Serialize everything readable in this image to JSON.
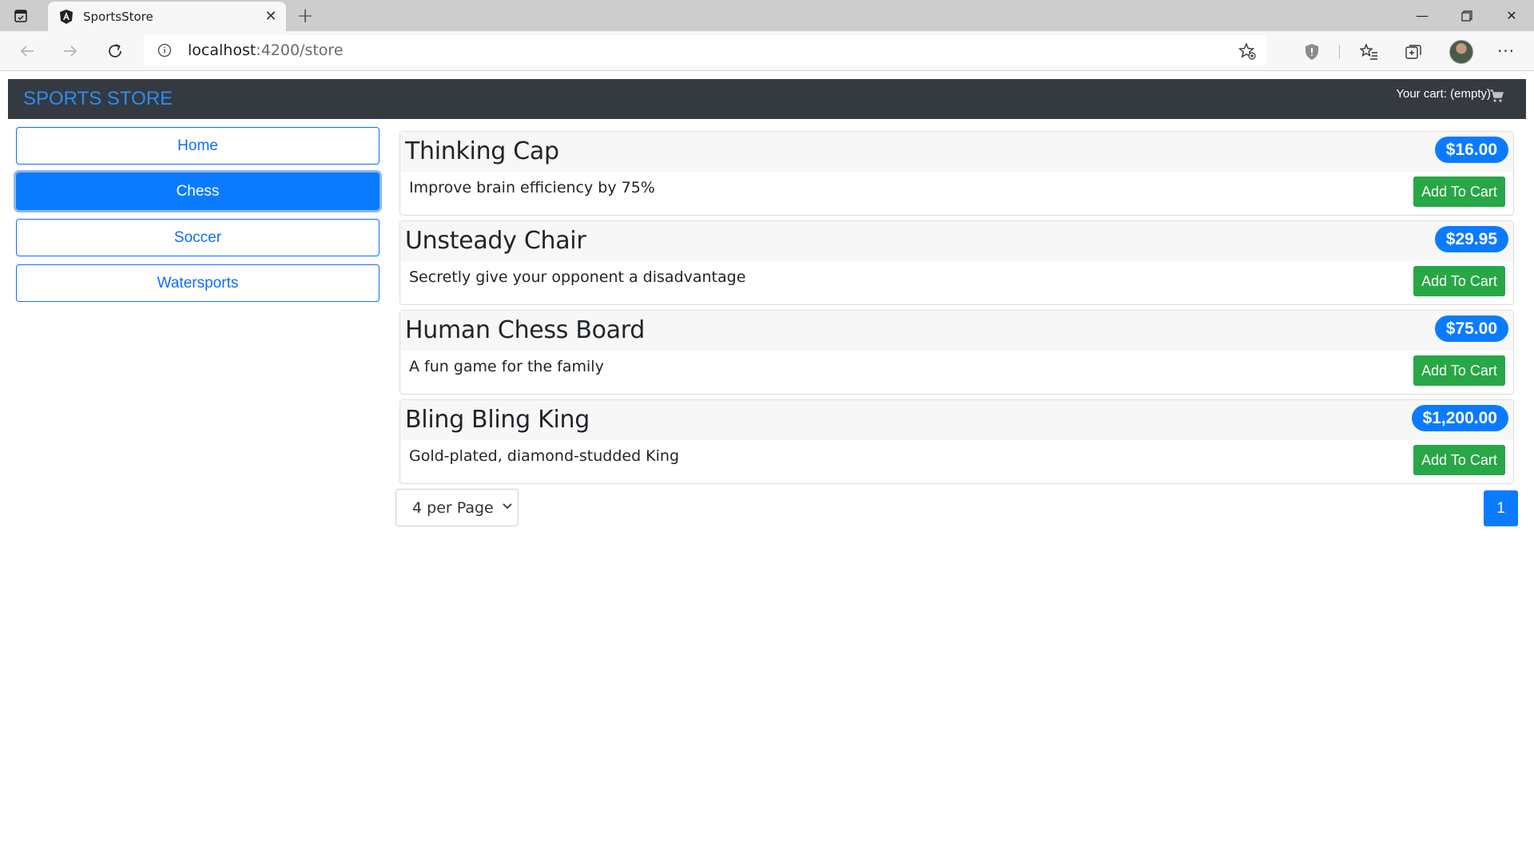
{
  "browser": {
    "tab_title": "SportsStore",
    "url_host": "localhost",
    "url_rest": ":4200/store",
    "icons": [
      "tab-actions-icon",
      "angular-icon",
      "close-icon",
      "plus-icon",
      "minimize-icon",
      "restore-icon",
      "close-window-icon",
      "back-icon",
      "forward-icon",
      "reload-icon",
      "info-icon",
      "add-favorite-icon",
      "shield-extension-icon",
      "favorites-icon",
      "collections-icon",
      "profile-avatar",
      "more-icon"
    ]
  },
  "header": {
    "brand": "SPORTS STORE",
    "cart_summary": "Your cart: (empty)",
    "cart_icon": "cart-icon"
  },
  "categories": [
    {
      "label": "Home",
      "active": false
    },
    {
      "label": "Chess",
      "active": true
    },
    {
      "label": "Soccer",
      "active": false
    },
    {
      "label": "Watersports",
      "active": false
    }
  ],
  "products": [
    {
      "name": "Thinking Cap",
      "price": "$16.00",
      "description": "Improve brain efficiency by 75%",
      "button": "Add To Cart"
    },
    {
      "name": "Unsteady Chair",
      "price": "$29.95",
      "description": "Secretly give your opponent a disadvantage",
      "button": "Add To Cart"
    },
    {
      "name": "Human Chess Board",
      "price": "$75.00",
      "description": "A fun game for the family",
      "button": "Add To Cart"
    },
    {
      "name": "Bling Bling King",
      "price": "$1,200.00",
      "description": "Gold-plated, diamond-studded King",
      "button": "Add To Cart"
    }
  ],
  "pagination": {
    "per_page_selected": "4 per Page",
    "current_page": "1"
  },
  "colors": {
    "primary": "#0a7bff",
    "success": "#27a745",
    "dark_header": "#343a40"
  }
}
